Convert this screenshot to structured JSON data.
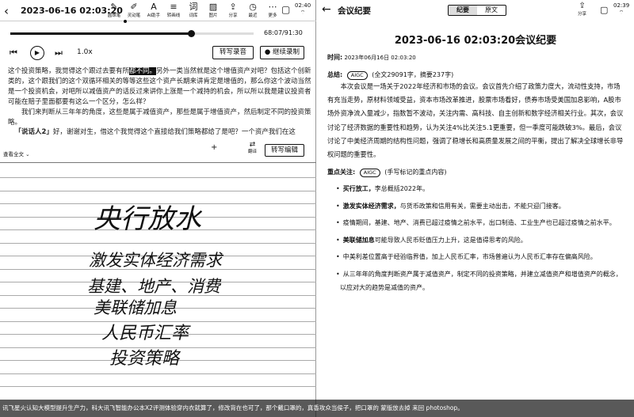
{
  "left": {
    "back_icon": "chevron-left-icon",
    "title": "2023-06-16 02:03:20",
    "tools": [
      {
        "icon": "pen-icon",
        "glyph": "✎",
        "label": "圆珠笔"
      },
      {
        "icon": "brush-icon",
        "glyph": "✐",
        "label": "灵动笔"
      },
      {
        "icon": "ai-helper-icon",
        "glyph": "A",
        "label": "AI助手"
      },
      {
        "icon": "underline-icon",
        "glyph": "≡",
        "label": "转画线"
      },
      {
        "icon": "dictionary-icon",
        "glyph": "词",
        "label": "词库"
      },
      {
        "icon": "image-icon",
        "glyph": "▨",
        "label": "图片"
      },
      {
        "icon": "share-icon",
        "glyph": "⇪",
        "label": "分享"
      },
      {
        "icon": "recent-icon",
        "glyph": "◷",
        "label": "最近"
      },
      {
        "icon": "more-icon",
        "glyph": "⋯",
        "label": "更多"
      }
    ],
    "status_time": "02:40",
    "player": {
      "progress": 0.743,
      "time": "68:07/91:30",
      "speed": "1.0x",
      "transcribe_label": "转写录音",
      "continue_label": "继续录制"
    },
    "transcript": {
      "p1_before": "这个投资策略，我觉得这个跟过去要有所",
      "p1_highlight": "都不同。",
      "p1_after": "另外一类当然就是这个增值资产对吧？包括这个创新类的，这个跟我们的这个双循环相关的等等这些这个资产长期来讲肯定是增值的，那么你这个波动当然是一个投资机会，对吧所以减值资产的话反过来讲你上涨是一个减持的机会，所以所以我是建议投资者可能在赔子里面都要有这么一个区分，怎么样？",
      "p2": "我们来判断从三年年的角度，这些是属于减值资产，那些是属于增值资产，然后制定不同的投资策略。",
      "speaker": "「说话人2」",
      "p3": "好，谢谢对生，借这个我觉得这个直接给我们策略都给了是吧？一个资产我们在这"
    },
    "view_full": "查看全文",
    "add_icon": "plus-icon",
    "translate_label": "翻译",
    "edit_label": "转写编辑"
  },
  "right": {
    "back_icon": "chevron-left-icon",
    "title": "会议纪要",
    "tabs": [
      "纪要",
      "原文"
    ],
    "share_label": "分享",
    "status_time": "02:39",
    "doc_title": "2023-06-16 02:03:20会议纪要",
    "time_label": "时间:",
    "time_value": "2023年06月16日 02:03:20",
    "summary_label": "总结:",
    "aigc_tag": "AIGC",
    "summary_stats": "(全文29091字，摘要237字)",
    "summary": "本次会议是一场关于2022年经济和市场的会议。会议首先介绍了政策力度大，流动性支持，市场有充当走势，原材料领域受益，资本市场改革推进，股票市场看好，债券市场受美国加息影响，A股市场外资净流入量减少，指数暂不波动，关注内需、高科技、自主创新和数字经济相关行业。其次，会议讨论了经济数据的重要性和趋势，认为关注4%比关注5.1更重要，但一季度可能跌破3%。最后，会议讨论了中美经济周期的结构性问题，强调了稳增长和高质量发展之间的平衡，提出了解决全球增长非导权问题的重要性。",
    "key_label": "重点关注:",
    "key_tag_note": "(手写标记的重点内容)",
    "key_points": [
      {
        "bold": "买行放工，",
        "text": "李总概括2022年。"
      },
      {
        "bold": "激发实体经济需求，",
        "text": "与货币政策和信用有关，需要主动出击，不能只迎门接客。"
      },
      {
        "bold": "",
        "text": "疫情期间，基建、地产、消费已超过疫情之前水平，出口制造、工业生产也已超过疫情之前水平。"
      },
      {
        "bold": "美联储加息",
        "text": "可能导致人民币贬值压力上升，这是值得思考的风险。"
      },
      {
        "bold": "",
        "text": "中美利差位置高于经验临界值，加上人民币汇率，市场普遍认为人民币汇率存在偏高风险。"
      },
      {
        "bold": "",
        "text": "从三年年的角度判断资产属于减值资产，制定不同的投资策略，并建立减值资产和增值资产的概念，以应对大的趋势是减值的资产。"
      }
    ]
  },
  "handwriting": [
    "央行放水",
    "激发实体经济需求",
    "基建、地产、消费",
    "美联储加息",
    "人民币汇率",
    "投资策略"
  ],
  "caption": "讯飞星火认知大模型提升生产力，科大讯飞智能办公本X2评测体验穿内衣就算了，修改背在也可了，那个戴口罩的，真香攻众当侯子，把口罩的 蒙版放去掉 来回 photoshop。"
}
